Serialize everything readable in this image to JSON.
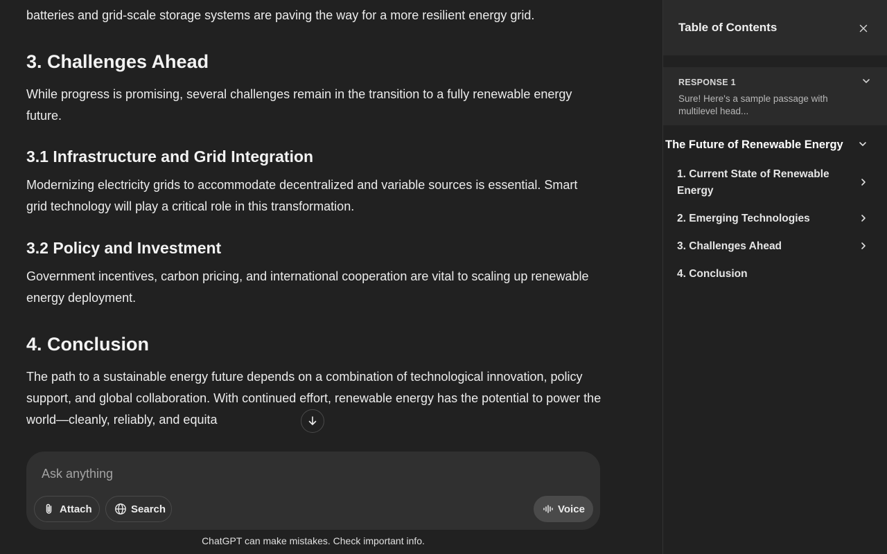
{
  "article": {
    "intro_tail": "batteries and grid-scale storage systems are paving the way for a more resilient energy grid.",
    "s3_heading": "3. Challenges Ahead",
    "s3_text": "While progress is promising, several challenges remain in the transition to a fully renewable energy future.",
    "s31_heading": "3.1 Infrastructure and Grid Integration",
    "s31_text": "Modernizing electricity grids to accommodate decentralized and variable sources is essential. Smart grid technology will play a critical role in this transformation.",
    "s32_heading": "3.2 Policy and Investment",
    "s32_text": "Government incentives, carbon pricing, and international cooperation are vital to scaling up renewable energy deployment.",
    "s4_heading": "4. Conclusion",
    "s4_text": "The path to a sustainable energy future depends on a combination of technological innovation, policy support, and global collaboration. With continued effort, renewable energy has the potential to power the world—cleanly, reliably, and equita"
  },
  "composer": {
    "placeholder": "Ask anything",
    "attach_label": "Attach",
    "search_label": "Search",
    "voice_label": "Voice"
  },
  "disclaimer": "ChatGPT can make mistakes. Check important info.",
  "toc": {
    "title": "Table of Contents",
    "response_label": "RESPONSE 1",
    "response_snippet": "Sure! Here's a sample passage with multilevel head...",
    "root": "The Future of Renewable Energy",
    "items": [
      {
        "label": "1. Current State of Renewable Energy",
        "has_children": true
      },
      {
        "label": "2. Emerging Technologies",
        "has_children": true
      },
      {
        "label": "3. Challenges Ahead",
        "has_children": true
      },
      {
        "label": "4. Conclusion",
        "has_children": false
      }
    ]
  },
  "icons": {
    "scroll": "arrow-down-icon",
    "attach": "paperclip-icon",
    "search": "globe-icon",
    "voice": "waveform-icon",
    "close": "close-icon",
    "expand": "chevron-down-icon",
    "item": "chevron-right-icon"
  }
}
